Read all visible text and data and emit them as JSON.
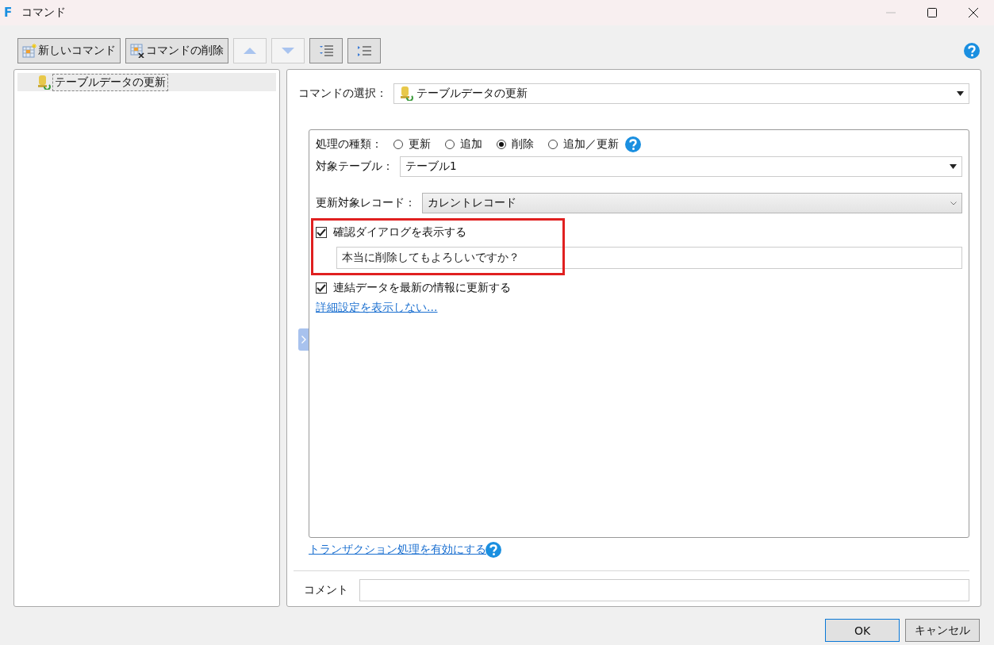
{
  "window": {
    "app_mark": "F",
    "title": "コマンド"
  },
  "toolbar": [
    {
      "kind": "text",
      "label": "新しいコマンド",
      "disabled": false
    },
    {
      "kind": "text",
      "label": "コマンドの削除",
      "disabled": false
    },
    {
      "kind": "icon",
      "disabled": true
    },
    {
      "kind": "icon",
      "disabled": true
    },
    {
      "kind": "icon",
      "disabled": false
    },
    {
      "kind": "icon",
      "disabled": false
    }
  ],
  "tree": {
    "items": [
      {
        "label": "テーブルデータの更新",
        "selected": true
      }
    ]
  },
  "command_select": {
    "label": "コマンドの選択：",
    "value": "テーブルデータの更新"
  },
  "settings": {
    "operation": {
      "label": "処理の種類：",
      "options": [
        {
          "label": "更新",
          "selected": false
        },
        {
          "label": "追加",
          "selected": false
        },
        {
          "label": "削除",
          "selected": true
        },
        {
          "label": "追加／更新",
          "selected": false
        }
      ]
    },
    "target_table": {
      "label": "対象テーブル：",
      "value": "テーブル1"
    },
    "target_record": {
      "label": "更新対象レコード：",
      "value": "カレントレコード"
    },
    "confirm_dialog": {
      "label": "確認ダイアログを表示する",
      "checked": true
    },
    "confirm_message": {
      "value": "本当に削除してもよろしいですか？"
    },
    "refresh_linked": {
      "label": "連結データを最新の情報に更新する",
      "checked": true
    },
    "details_link": "詳細設定を表示しない…"
  },
  "transaction_link": "トランザクション処理を有効にする",
  "comment": {
    "label": "コメント"
  },
  "buttons": [
    {
      "label": "OK",
      "kind": "primary"
    },
    {
      "label": "キャンセル",
      "kind": "normal"
    }
  ]
}
